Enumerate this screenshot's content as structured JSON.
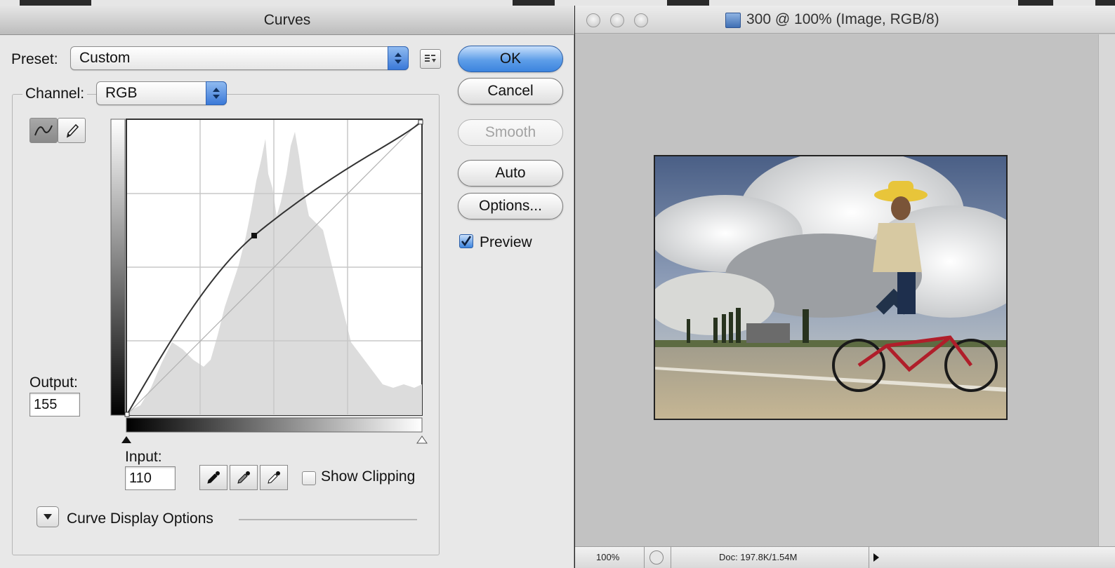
{
  "curves_dialog": {
    "title": "Curves",
    "preset_label": "Preset:",
    "preset_value": "Custom",
    "channel_label": "Channel:",
    "channel_value": "RGB",
    "output_label": "Output:",
    "output_value": "155",
    "input_label": "Input:",
    "input_value": "110",
    "show_clipping_label": "Show Clipping",
    "show_clipping_checked": false,
    "curve_display_options_label": "Curve Display Options",
    "buttons": {
      "ok": "OK",
      "cancel": "Cancel",
      "smooth": "Smooth",
      "auto": "Auto",
      "options": "Options..."
    },
    "preview_label": "Preview",
    "preview_checked": true,
    "curve": {
      "control_point": {
        "input": 110,
        "output": 155
      },
      "range": [
        0,
        255
      ]
    },
    "icons": [
      "curve-tool-icon",
      "pencil-icon",
      "preset-options-icon",
      "black-point-eyedropper-icon",
      "gray-point-eyedropper-icon",
      "white-point-eyedropper-icon",
      "expand-triangle-icon"
    ]
  },
  "document_window": {
    "title": "300 @ 100% (Image, RGB/8)",
    "zoom": "100%",
    "doc_info": "Doc: 197.8K/1.54M",
    "accent_color": "#3c84de"
  }
}
